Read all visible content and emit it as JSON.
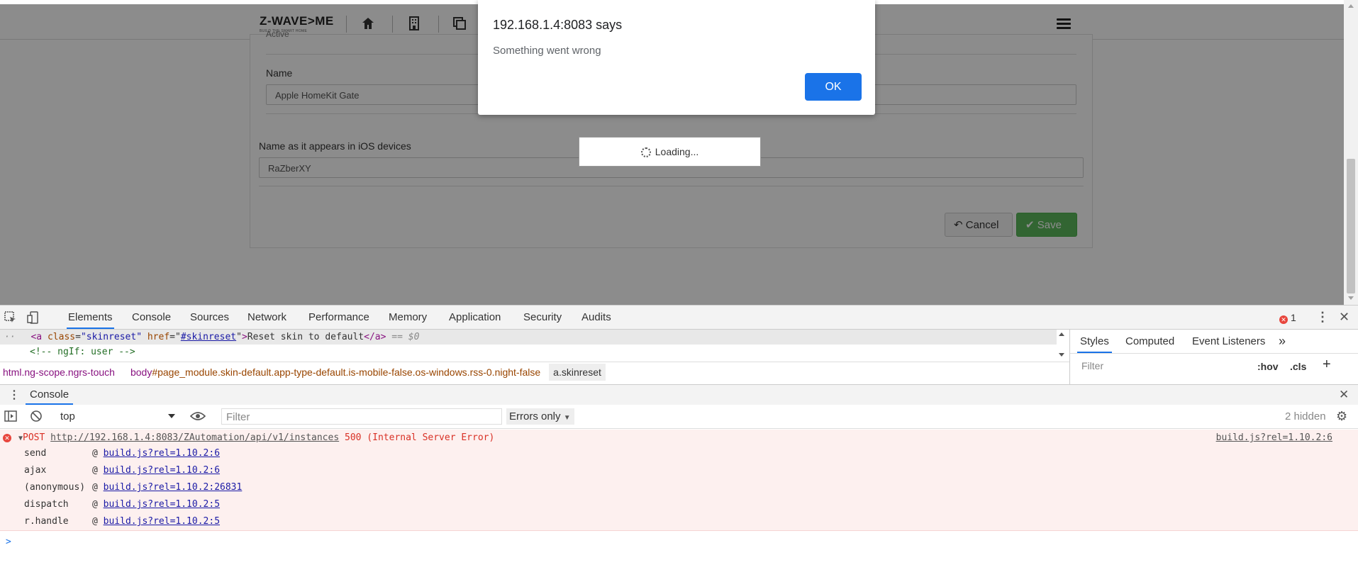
{
  "navbar": {
    "logo_text": "Z-WAVE>ME",
    "logo_tagline": "BUILD THE SMART HOME"
  },
  "form": {
    "partial_label": "Active",
    "name_label": "Name",
    "name_value": "Apple HomeKit Gate",
    "ios_label": "Name as it appears in iOS devices",
    "ios_value": "RaZberXY",
    "cancel_label": "Cancel",
    "save_label": "Save"
  },
  "loading_text": "Loading...",
  "alert": {
    "title": "192.168.1.4:8083 says",
    "message": "Something went wrong",
    "ok_label": "OK"
  },
  "devtools": {
    "tabs": [
      "Elements",
      "Console",
      "Sources",
      "Network",
      "Performance",
      "Memory",
      "Application",
      "Security",
      "Audits"
    ],
    "active_tab": "Elements",
    "error_count": "1",
    "elements": {
      "selected_line": {
        "tag_open": "<a",
        "class_attr": "class",
        "class_val": "\"skinreset\"",
        "href_attr": "href",
        "href_val": "#skinreset",
        "text": "Reset skin to default",
        "tag_close": "</a>",
        "eq": "== $0"
      },
      "comment_line": "<!-- ngIf: user -->"
    },
    "breadcrumb": {
      "html": "html.ng-scope.ngrs-touch",
      "body_tag": "body",
      "body_rest": "#page_module.skin-default.app-type-default.is-mobile-false.os-windows.rss-0.night-false",
      "a": "a.skinreset"
    },
    "styles": {
      "tabs": [
        "Styles",
        "Computed",
        "Event Listeners"
      ],
      "more": "»",
      "filter_placeholder": "Filter",
      "hov": ":hov",
      "cls": ".cls",
      "plus": "+"
    },
    "drawer": {
      "tab": "Console",
      "context": "top",
      "filter_placeholder": "Filter",
      "levels": "Errors only",
      "hidden": "2 hidden"
    },
    "error": {
      "method": "POST",
      "url": "http://192.168.1.4:8083/ZAutomation/api/v1/instances",
      "status": "500 (Internal Server Error)",
      "source": "build.js?rel=1.10.2:6",
      "stack": [
        {
          "fn": "send",
          "at": "@",
          "link": "build.js?rel=1.10.2:6"
        },
        {
          "fn": "ajax",
          "at": "@",
          "link": "build.js?rel=1.10.2:6"
        },
        {
          "fn": "(anonymous)",
          "at": "@",
          "link": "build.js?rel=1.10.2:26831"
        },
        {
          "fn": "dispatch",
          "at": "@",
          "link": "build.js?rel=1.10.2:5"
        },
        {
          "fn": "r.handle",
          "at": "@",
          "link": "build.js?rel=1.10.2:5"
        }
      ]
    },
    "prompt": ">"
  },
  "colors": {
    "accent": "#1a73e8",
    "save_green": "#5cb85c",
    "error_red": "#d93025",
    "error_bg": "#fdf0ef"
  }
}
